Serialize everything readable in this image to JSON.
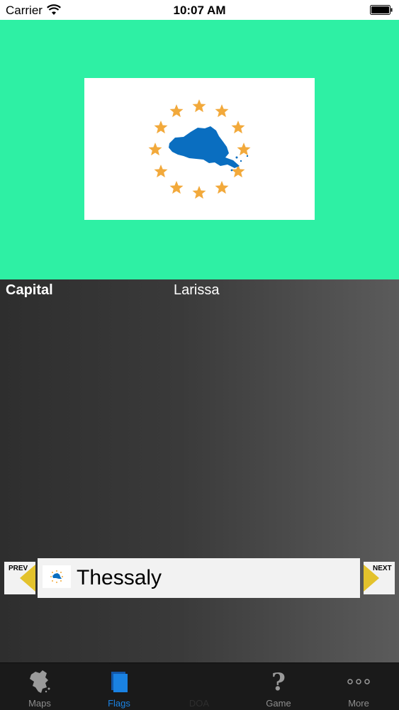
{
  "status_bar": {
    "carrier": "Carrier",
    "time": "10:07 AM"
  },
  "flag": {
    "background_color": "#2ef0a4",
    "icon": "thessaly-flag"
  },
  "info": {
    "capital_label": "Capital",
    "capital_value": "Larissa"
  },
  "nav": {
    "prev_label": "PREV",
    "next_label": "NEXT",
    "region_name": "Thessaly"
  },
  "tab_bar": {
    "active_color": "#1a82e2",
    "tabs": [
      {
        "label": "Maps",
        "icon": "map-icon"
      },
      {
        "label": "Flags",
        "icon": "flags-icon",
        "active": true
      },
      {
        "label": "DOA",
        "icon": "doa-icon",
        "disabled": true
      },
      {
        "label": "Game",
        "icon": "question-icon"
      },
      {
        "label": "More",
        "icon": "more-icon"
      }
    ]
  }
}
